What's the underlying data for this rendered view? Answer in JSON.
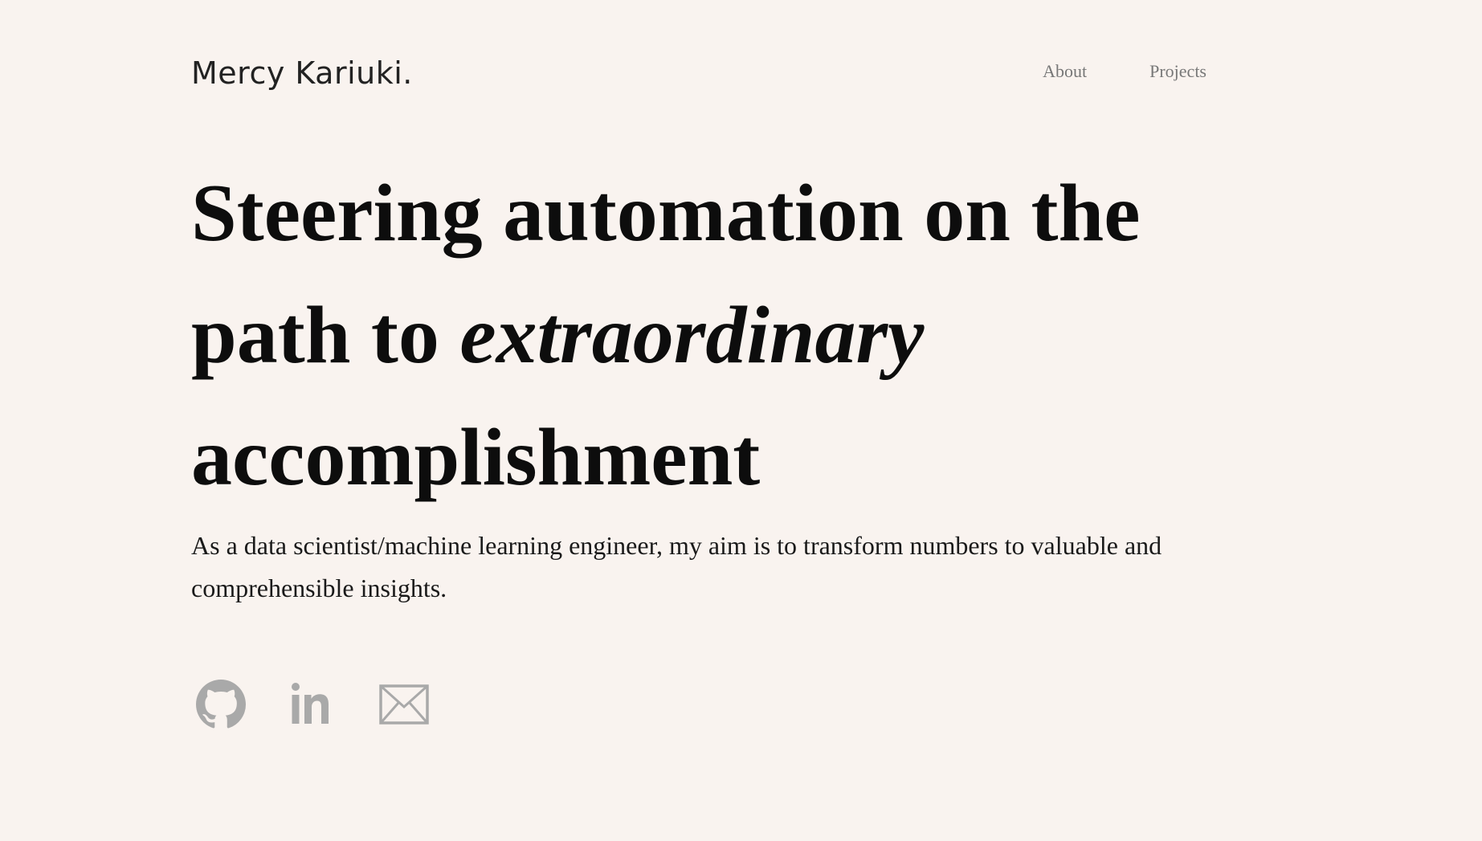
{
  "header": {
    "logo_text": "Mercy Kariuki.",
    "nav": [
      {
        "label": "About"
      },
      {
        "label": "Projects"
      }
    ]
  },
  "hero": {
    "headline_part1": "Steering automation on the path to ",
    "headline_emphasis": "extraordinary",
    "headline_part2": " accomplishment",
    "intro": "As a data scientist/machine learning engineer, my aim is to transform numbers to valuable and comprehensible insights."
  },
  "socials": [
    {
      "icon": "github-icon"
    },
    {
      "icon": "linkedin-icon"
    },
    {
      "icon": "mail-icon"
    }
  ],
  "colors": {
    "background": "#f9f3ef",
    "text": "#0d0d0d",
    "nav_text": "#777777",
    "icon": "#a9a9a9"
  }
}
